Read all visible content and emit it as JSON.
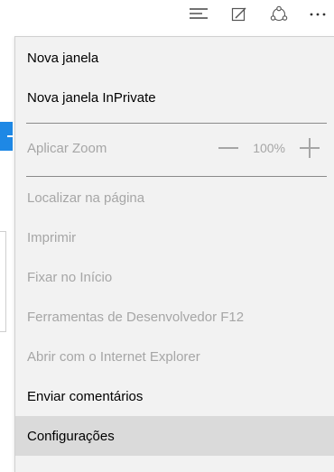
{
  "toolbar": {
    "icons": [
      "hub-icon",
      "web-note-icon",
      "share-icon",
      "more-icon"
    ]
  },
  "menu": {
    "new_window": "Nova janela",
    "new_inprivate_window": "Nova janela InPrivate",
    "zoom_label": "Aplicar Zoom",
    "zoom_value": "100%",
    "find_on_page": "Localizar na página",
    "print": "Imprimir",
    "pin_to_start": "Fixar no Início",
    "developer_tools": "Ferramentas de Desenvolvedor F12",
    "open_with_ie": "Abrir com o Internet Explorer",
    "send_feedback": "Enviar comentários",
    "settings": "Configurações"
  },
  "colors": {
    "menu_background": "#f2f2f2",
    "hover_background": "#dadada",
    "disabled_text": "#a6a6a6",
    "accent_blue": "#1e88e5"
  }
}
